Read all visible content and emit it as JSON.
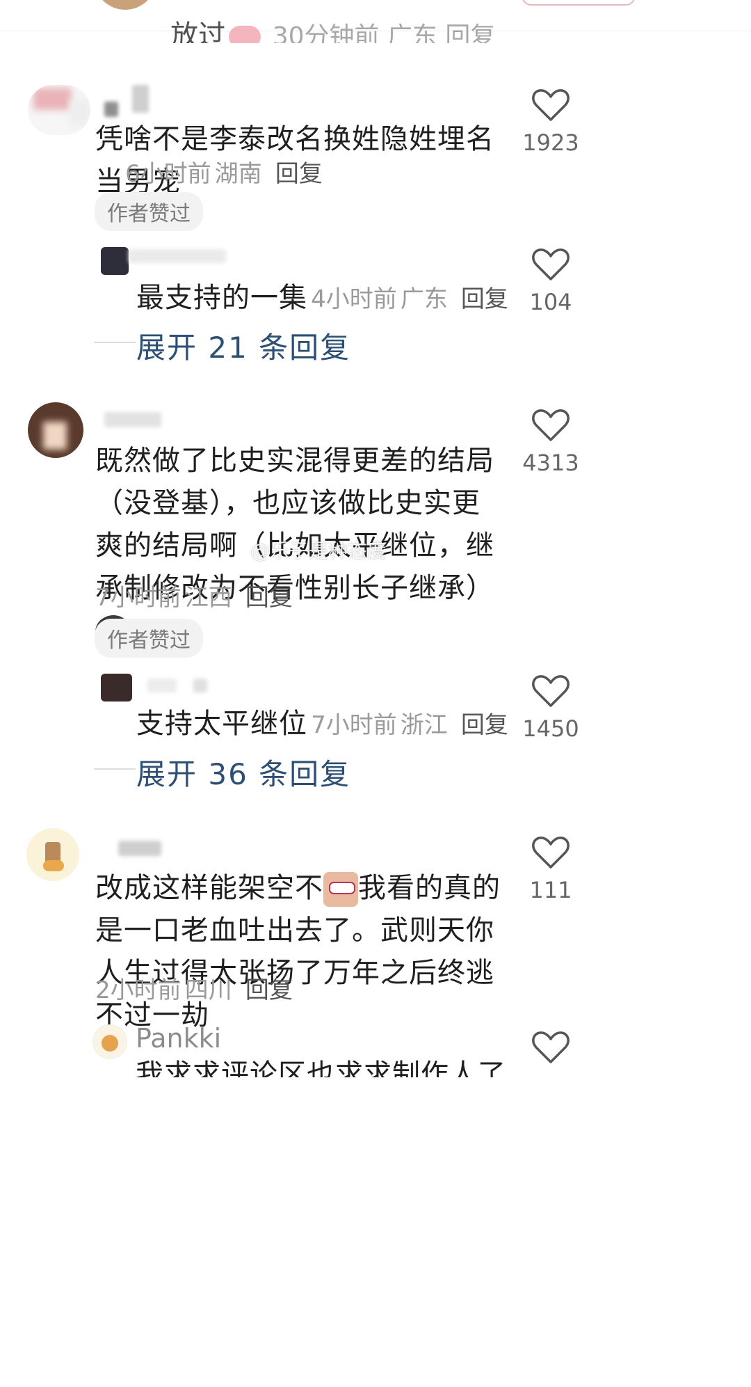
{
  "top_clip": {
    "text": "放过",
    "meta": "30分钟前 广东 回复"
  },
  "comments": [
    {
      "text": "凭啥不是李泰改名换姓隐姓埋名当男宠",
      "time": "6小时前",
      "location": "湖南",
      "reply_label": "回复",
      "badge": "作者赞过",
      "likes": "1923",
      "sub_reply": {
        "text": "最支持的一集",
        "time": "4小时前",
        "location": "广东",
        "reply_label": "回复",
        "likes": "104"
      },
      "expand_label": "展开 21 条回复"
    },
    {
      "text": "既然做了比史实混得更差的结局（没登基），也应该做比史实更爽的结局啊（比如太平继位，继承制修改为不看性别长子继承）",
      "time": "7小时前",
      "location": "江西",
      "reply_label": "回复",
      "badge": "作者赞过",
      "likes": "4313",
      "sub_reply": {
        "text": "支持太平继位",
        "time": "7小时前",
        "location": "浙江",
        "reply_label": "回复",
        "likes": "1450"
      },
      "expand_label": "展开 36 条回复"
    },
    {
      "text_before_emoji": "改成这样能架空不",
      "text_after_emoji": "我看的真的是一口老血吐出去了。武则天你人生过得太张扬了万年之后终逃不过一劫",
      "time": "2小时前",
      "location": "四川",
      "reply_label": "回复",
      "likes": "111"
    },
    {
      "username": "Pankki",
      "text": "我求求评论区也求求制作人了"
    }
  ],
  "watermark": "@乐子是种态度",
  "icons": {
    "like": "heart-outline-icon",
    "emoji_pig": "pig-emoji-icon",
    "emoji_cat": "cat-emoji-icon",
    "emoji_shocked": "shocked-face-emoji-icon"
  },
  "colors": {
    "expand_text": "#2d4f73",
    "meta_text": "#9a9a9a",
    "badge_bg": "#f2f2f2"
  }
}
